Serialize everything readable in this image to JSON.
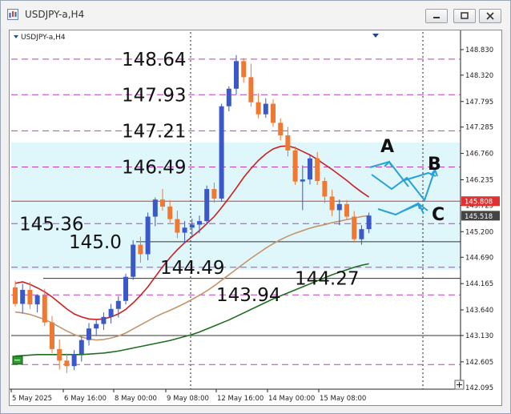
{
  "window": {
    "title": "USDJPY-a,H4"
  },
  "chart_data": {
    "type": "candlestick",
    "symbol_label": "USDJPY-a,H4",
    "x_ticks": [
      "5 May 2025",
      "6 May 16:00",
      "8 May 00:00",
      "9 May 08:00",
      "12 May 16:00",
      "14 May 00:00",
      "15 May 08:00"
    ],
    "y_ticks": [
      148.83,
      148.32,
      147.795,
      147.285,
      146.76,
      146.235,
      145.725,
      145.2,
      144.69,
      144.165,
      143.64,
      143.13,
      142.605,
      142.095
    ],
    "y_tick_labels": [
      "148.830",
      "148.320",
      "147.795",
      "147.285",
      "146.760",
      "146.235",
      "145.725",
      "145.200",
      "144.690",
      "144.165",
      "143.640",
      "143.130",
      "142.605",
      "142.095"
    ],
    "ylim": [
      142.06,
      149.18
    ],
    "level_labels": [
      "148.64",
      "147.93",
      "147.21",
      "146.49",
      "145.36",
      "145.0",
      "144.49",
      "143.94",
      "144.27"
    ],
    "dashed_levels": [
      148.64,
      147.93,
      147.21,
      146.49,
      145.36,
      144.49,
      143.94,
      142.55
    ],
    "solid_levels": [
      145.0,
      144.27,
      143.13
    ],
    "price_tags": [
      {
        "label": "145.808",
        "value": 145.808,
        "color": "#e03030"
      },
      {
        "label": "145.518",
        "value": 145.518,
        "color": "#444444"
      }
    ],
    "highlight_zone": [
      144.44,
      146.98
    ],
    "scenario_labels": [
      "A",
      "B",
      "C"
    ],
    "candles": [
      {
        "o": 144.09,
        "h": 144.22,
        "l": 143.71,
        "c": 143.76
      },
      {
        "o": 143.76,
        "h": 144.16,
        "l": 143.57,
        "c": 144.04
      },
      {
        "o": 144.04,
        "h": 144.2,
        "l": 143.66,
        "c": 143.75
      },
      {
        "o": 143.75,
        "h": 143.95,
        "l": 143.59,
        "c": 143.93
      },
      {
        "o": 143.93,
        "h": 144.06,
        "l": 143.32,
        "c": 143.39
      },
      {
        "o": 143.39,
        "h": 143.52,
        "l": 142.78,
        "c": 142.86
      },
      {
        "o": 142.86,
        "h": 143.05,
        "l": 142.45,
        "c": 142.63
      },
      {
        "o": 142.63,
        "h": 142.77,
        "l": 142.38,
        "c": 142.52
      },
      {
        "o": 142.52,
        "h": 142.84,
        "l": 142.44,
        "c": 142.76
      },
      {
        "o": 142.76,
        "h": 143.11,
        "l": 142.61,
        "c": 143.04
      },
      {
        "o": 143.04,
        "h": 143.38,
        "l": 142.93,
        "c": 143.27
      },
      {
        "o": 143.27,
        "h": 143.44,
        "l": 143.13,
        "c": 143.36
      },
      {
        "o": 143.36,
        "h": 143.59,
        "l": 143.24,
        "c": 143.5
      },
      {
        "o": 143.5,
        "h": 143.76,
        "l": 143.37,
        "c": 143.66
      },
      {
        "o": 143.66,
        "h": 143.92,
        "l": 143.49,
        "c": 143.82
      },
      {
        "o": 143.82,
        "h": 144.36,
        "l": 143.75,
        "c": 144.3
      },
      {
        "o": 144.3,
        "h": 145.03,
        "l": 144.24,
        "c": 144.94
      },
      {
        "o": 144.94,
        "h": 145.1,
        "l": 144.58,
        "c": 144.75
      },
      {
        "o": 144.75,
        "h": 145.58,
        "l": 144.63,
        "c": 145.5
      },
      {
        "o": 145.5,
        "h": 145.88,
        "l": 145.31,
        "c": 145.84
      },
      {
        "o": 145.84,
        "h": 146.05,
        "l": 145.62,
        "c": 145.7
      },
      {
        "o": 145.7,
        "h": 145.83,
        "l": 145.38,
        "c": 145.45
      },
      {
        "o": 145.45,
        "h": 145.62,
        "l": 145.07,
        "c": 145.18
      },
      {
        "o": 145.18,
        "h": 145.41,
        "l": 144.98,
        "c": 145.28
      },
      {
        "o": 145.28,
        "h": 145.46,
        "l": 145.09,
        "c": 145.34
      },
      {
        "o": 145.34,
        "h": 145.52,
        "l": 145.17,
        "c": 145.41
      },
      {
        "o": 145.41,
        "h": 146.12,
        "l": 145.34,
        "c": 146.05
      },
      {
        "o": 146.05,
        "h": 146.18,
        "l": 145.78,
        "c": 145.86
      },
      {
        "o": 145.86,
        "h": 147.75,
        "l": 145.8,
        "c": 147.7
      },
      {
        "o": 147.7,
        "h": 148.1,
        "l": 147.6,
        "c": 148.05
      },
      {
        "o": 148.05,
        "h": 148.72,
        "l": 147.93,
        "c": 148.6
      },
      {
        "o": 148.6,
        "h": 148.66,
        "l": 148.17,
        "c": 148.28
      },
      {
        "o": 148.28,
        "h": 148.55,
        "l": 147.69,
        "c": 147.78
      },
      {
        "o": 147.78,
        "h": 147.96,
        "l": 147.46,
        "c": 147.54
      },
      {
        "o": 147.54,
        "h": 147.86,
        "l": 147.47,
        "c": 147.75
      },
      {
        "o": 147.75,
        "h": 147.84,
        "l": 147.29,
        "c": 147.37
      },
      {
        "o": 147.37,
        "h": 147.46,
        "l": 147.02,
        "c": 147.12
      },
      {
        "o": 147.12,
        "h": 147.29,
        "l": 146.7,
        "c": 146.82
      },
      {
        "o": 146.82,
        "h": 146.9,
        "l": 146.13,
        "c": 146.2
      },
      {
        "o": 146.2,
        "h": 146.52,
        "l": 145.63,
        "c": 146.24
      },
      {
        "o": 146.24,
        "h": 146.73,
        "l": 146.14,
        "c": 146.66
      },
      {
        "o": 146.66,
        "h": 146.79,
        "l": 146.13,
        "c": 146.21
      },
      {
        "o": 146.21,
        "h": 146.28,
        "l": 145.77,
        "c": 145.9
      },
      {
        "o": 145.9,
        "h": 146.04,
        "l": 145.51,
        "c": 145.63
      },
      {
        "o": 145.63,
        "h": 145.84,
        "l": 145.33,
        "c": 145.75
      },
      {
        "o": 145.75,
        "h": 145.83,
        "l": 145.44,
        "c": 145.5
      },
      {
        "o": 145.5,
        "h": 145.61,
        "l": 144.98,
        "c": 145.05
      },
      {
        "o": 145.05,
        "h": 145.33,
        "l": 144.94,
        "c": 145.25
      },
      {
        "o": 145.25,
        "h": 145.58,
        "l": 145.17,
        "c": 145.52
      }
    ],
    "ma_series": [
      {
        "color": "#cc1f1f",
        "values": [
          144.17,
          144.2,
          144.15,
          144.08,
          144.0,
          143.9,
          143.78,
          143.66,
          143.56,
          143.5,
          143.46,
          143.45,
          143.46,
          143.5,
          143.56,
          143.65,
          143.78,
          143.93,
          144.1,
          144.3,
          144.5,
          144.68,
          144.84,
          144.98,
          145.1,
          145.22,
          145.36,
          145.5,
          145.68,
          145.87,
          146.07,
          146.28,
          146.46,
          146.62,
          146.75,
          146.85,
          146.9,
          146.91,
          146.87,
          146.8,
          146.73,
          146.64,
          146.54,
          146.44,
          146.33,
          146.22,
          146.1,
          145.99,
          145.89
        ]
      },
      {
        "color": "#c4956a",
        "values": [
          143.6,
          143.58,
          143.55,
          143.5,
          143.45,
          143.38,
          143.3,
          143.22,
          143.15,
          143.1,
          143.06,
          143.04,
          143.05,
          143.08,
          143.12,
          143.18,
          143.26,
          143.34,
          143.42,
          143.5,
          143.57,
          143.63,
          143.7,
          143.77,
          143.85,
          143.93,
          144.02,
          144.12,
          144.23,
          144.34,
          144.45,
          144.56,
          144.67,
          144.77,
          144.87,
          144.96,
          145.04,
          145.11,
          145.17,
          145.22,
          145.27,
          145.31,
          145.34,
          145.38,
          145.41,
          145.44,
          145.47,
          145.5,
          145.52
        ]
      },
      {
        "color": "#1e6e1e",
        "values": [
          142.72,
          142.73,
          142.74,
          142.75,
          142.75,
          142.75,
          142.75,
          142.75,
          142.75,
          142.75,
          142.76,
          142.77,
          142.78,
          142.8,
          142.82,
          142.85,
          142.88,
          142.91,
          142.94,
          142.97,
          143.0,
          143.03,
          143.07,
          143.11,
          143.15,
          143.2,
          143.26,
          143.32,
          143.38,
          143.44,
          143.51,
          143.58,
          143.65,
          143.72,
          143.79,
          143.86,
          143.92,
          143.98,
          144.04,
          144.1,
          144.16,
          144.22,
          144.28,
          144.34,
          144.39,
          144.44,
          144.49,
          144.53,
          144.56
        ]
      }
    ]
  }
}
